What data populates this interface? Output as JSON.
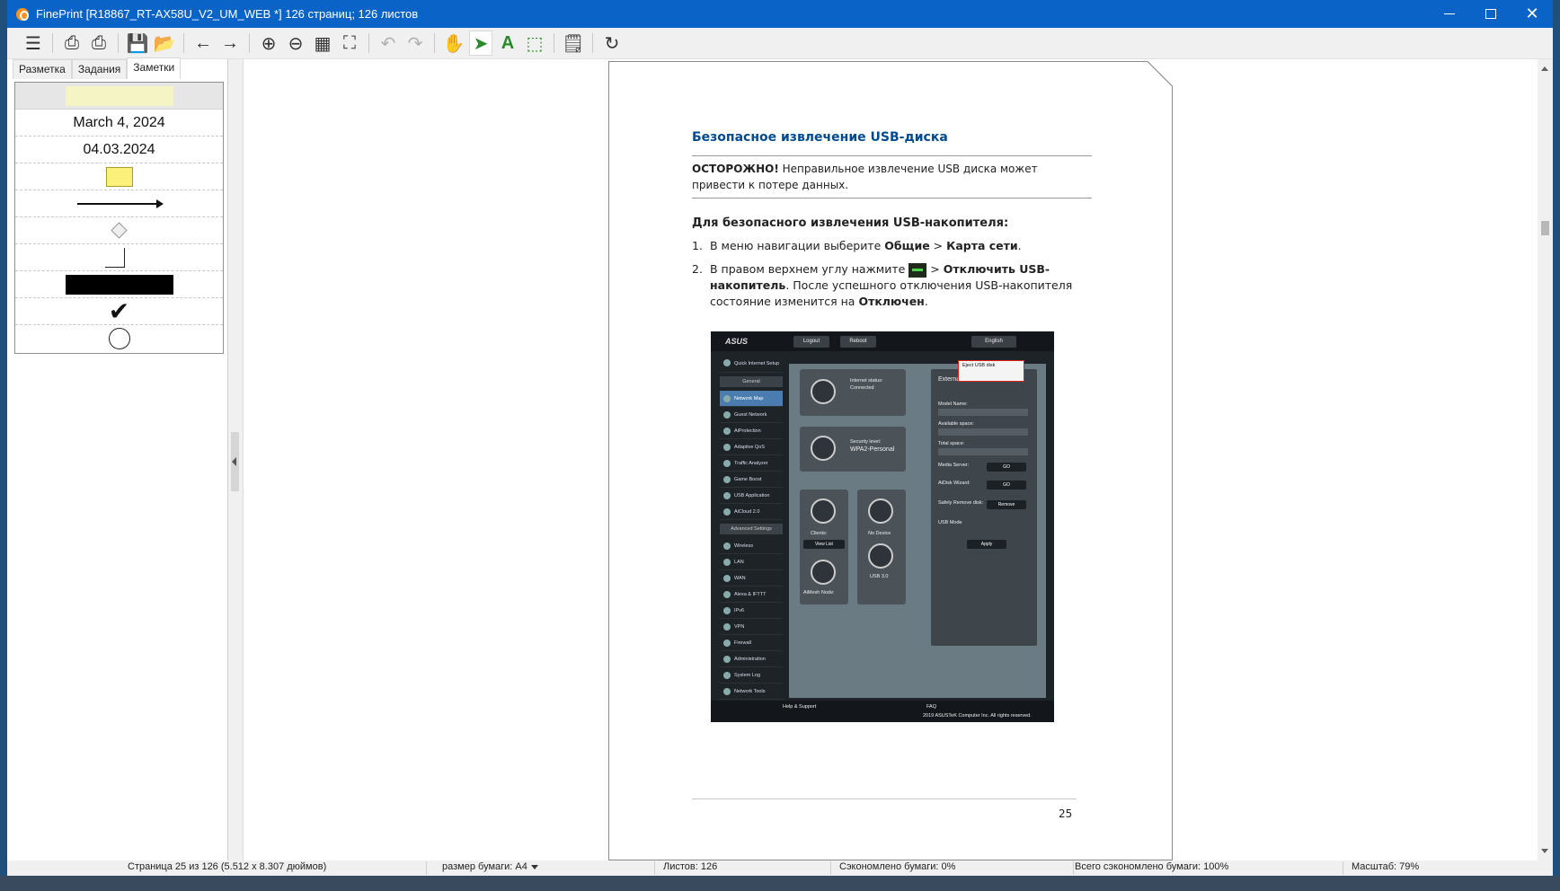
{
  "window": {
    "title": "FinePrint [R18867_RT-AX58U_V2_UM_WEB *] 126 страниц; 126 листов",
    "close_glyph": "✕"
  },
  "toolbar": {
    "icons": [
      "menu-icon",
      "print-icon",
      "print-settings-icon",
      "save-icon",
      "open-folder-icon",
      "back-arrow-icon",
      "forward-arrow-icon",
      "zoom-in-icon",
      "zoom-out-icon",
      "grid-icon",
      "fit-page-icon",
      "undo-icon",
      "redo-icon",
      "hand-icon",
      "pointer-icon",
      "text-tool-icon",
      "select-region-icon",
      "notes-icon",
      "refresh-icon"
    ],
    "glyphs": {
      "menu": "☰",
      "print": "⎙",
      "print_settings": "⎙",
      "save": "💾",
      "open": "📂",
      "back": "←",
      "forward": "→",
      "zoom_in": "⊕",
      "zoom_out": "⊖",
      "grid": "▦",
      "fit": "⛶",
      "undo": "↶",
      "redo": "↷",
      "hand": "✋",
      "pointer": "➤",
      "text": "A",
      "select": "⬚",
      "notes": "🗒",
      "refresh": "↻"
    },
    "accent_green": "#3a9c2e"
  },
  "left_panel": {
    "tabs": [
      "Разметка",
      "Задания",
      "Заметки"
    ],
    "active_tab": 2,
    "notes": {
      "date_long": "March 4, 2024",
      "date_short": "04.03.2024"
    }
  },
  "document": {
    "heading": "Безопасное извлечение USB-диска",
    "caution_label": "ОСТОРОЖНО!",
    "caution_text": " Неправильное извлечение USB диска может привести к потере данных.",
    "steps_heading": "Для безопасного извлечения USB-накопителя:",
    "step1_num": "1.",
    "step1_text": "В меню навигации выберите ",
    "step1_bold1": "Общие",
    "step1_gt": " > ",
    "step1_bold2": "Карта сети",
    "step1_end": ".",
    "step2_num": "2.",
    "step2_text": "В правом верхнем углу нажмите ",
    "step2_gt": " > ",
    "step2_bold1": "Отключить USB-накопитель",
    "step2_text2": ". После успешного отключения USB-накопителя состояние изменится на ",
    "step2_bold2": "Отключен",
    "step2_end": ".",
    "page_number": "25",
    "screenshot": {
      "logo": "ASUS",
      "logout": "Logout",
      "reboot": "Reboot",
      "language": "English",
      "sidebar_general": "General",
      "sidebar_advanced": "Advanced Settings",
      "menu_top": [
        "Quick Internet Setup"
      ],
      "menu_general": [
        "Network Map",
        "Guest Network",
        "AiProtection",
        "Adaptive QoS",
        "Traffic Analyzer",
        "Game Boost",
        "USB Application",
        "AiCloud 2.0"
      ],
      "menu_advanced": [
        "Wireless",
        "LAN",
        "WAN",
        "Alexa & IFTTT",
        "IPv6",
        "VPN",
        "Firewall",
        "Administration",
        "System Log",
        "Network Tools"
      ],
      "internet_status": "Internet status:",
      "connected": "Connected",
      "security_level": "Security level:",
      "wpa": "WPA2-Personal",
      "clients": "Clients:",
      "view_list": "View List",
      "no_device": "No Device",
      "usb": "USB 3.0",
      "aimesh": "AiMesh Node:",
      "panel_title": "External",
      "eject": "Eject USB disk",
      "model_name": "Model Name:",
      "available": "Available space:",
      "total": "Total space:",
      "media": "Media Server:",
      "aidisk": "AiDisk Wizard:",
      "safely_remove": "Safely Remove disk:",
      "remove": "Remove",
      "usb_mode": "USB Mode",
      "go": "GO",
      "apply": "Apply",
      "help": "Help & Support",
      "faq": "FAQ",
      "copyright": "2019 ASUSTeK Computer Inc. All rights reserved."
    }
  },
  "status": {
    "page_info": "Страница 25 из 126 (5.512 x 8.307 дюймов)",
    "paper_size": "размер бумаги: A4",
    "sheets": "Листов: 126",
    "saved": "Сэкономлено бумаги: 0%",
    "total_saved": "Всего сэкономлено бумаги: 100%",
    "zoom": "Масштаб: 79%"
  }
}
